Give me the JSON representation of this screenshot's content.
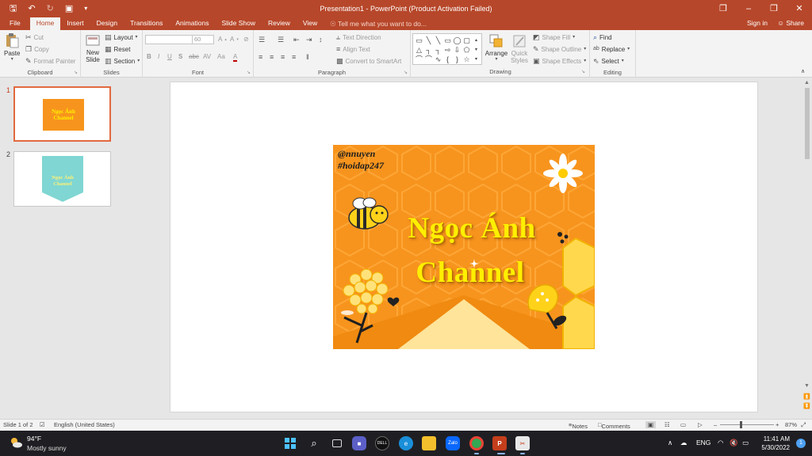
{
  "window": {
    "title": "Presentation1 - PowerPoint (Product Activation Failed)"
  },
  "tabs": [
    {
      "label": "File"
    },
    {
      "label": "Home"
    },
    {
      "label": "Insert"
    },
    {
      "label": "Design"
    },
    {
      "label": "Transitions"
    },
    {
      "label": "Animations"
    },
    {
      "label": "Slide Show"
    },
    {
      "label": "Review"
    },
    {
      "label": "View"
    }
  ],
  "tell_me": "Tell me what you want to do...",
  "account": {
    "sign_in": "Sign in",
    "share": "Share"
  },
  "ribbon": {
    "clipboard": {
      "label": "Clipboard",
      "paste": "Paste",
      "cut": "Cut",
      "copy": "Copy",
      "format_painter": "Format Painter"
    },
    "slides": {
      "label": "Slides",
      "new_slide": "New Slide",
      "layout": "Layout",
      "reset": "Reset",
      "section": "Section"
    },
    "font": {
      "label": "Font",
      "size": "60"
    },
    "paragraph": {
      "label": "Paragraph",
      "text_direction": "Text Direction",
      "align_text": "Align Text",
      "convert_smartart": "Convert to SmartArt"
    },
    "drawing": {
      "label": "Drawing",
      "arrange": "Arrange",
      "quick_styles": "Quick Styles",
      "shape_fill": "Shape Fill",
      "shape_outline": "Shape Outline",
      "shape_effects": "Shape Effects"
    },
    "editing": {
      "label": "Editing",
      "find": "Find",
      "replace": "Replace",
      "select": "Select"
    }
  },
  "thumbnails": [
    {
      "number": "1",
      "text": "Ngọc Ánh Channel"
    },
    {
      "number": "2",
      "text": "Ngọc Ánh Channel"
    }
  ],
  "slide_image": {
    "handle": "@nnuyen",
    "hashtag": "#hoidap247",
    "title_line1": "Ngọc Ánh",
    "title_line2": "Channel"
  },
  "status": {
    "slide_of": "Slide 1 of 2",
    "language": "English (United States)",
    "notes": "Notes",
    "comments": "Comments",
    "zoom": "87%"
  },
  "taskbar": {
    "temperature": "94°F",
    "condition": "Mostly sunny",
    "language": "ENG",
    "time": "11:41 AM",
    "date": "5/30/2022",
    "notification_count": "1",
    "zalo_label": "Zalo"
  },
  "colors": {
    "brand": "#b7472a",
    "slide_orange": "#f7941d",
    "title_yellow": "#ffef00"
  }
}
